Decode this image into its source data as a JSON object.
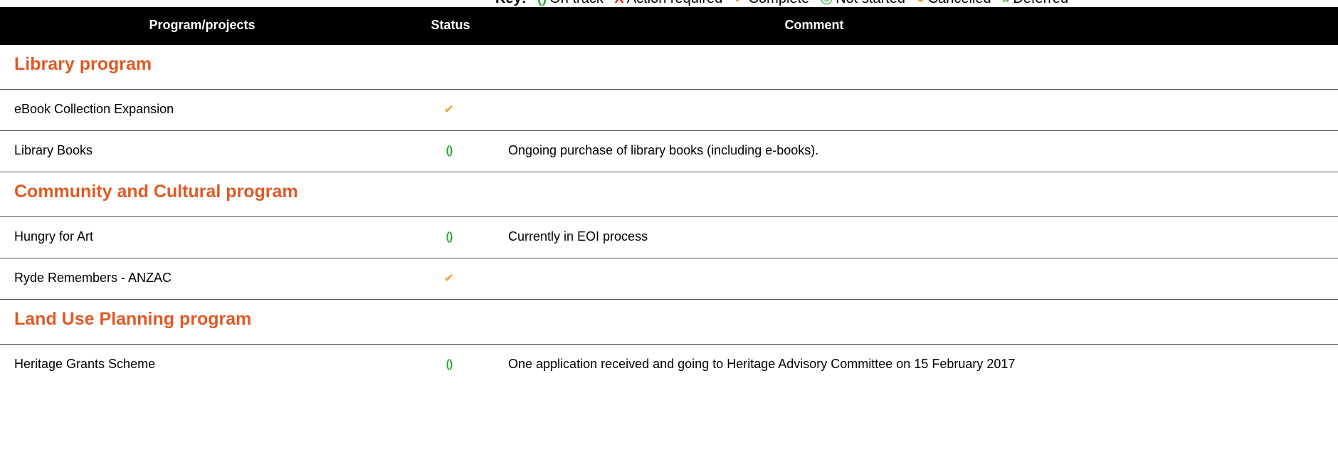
{
  "key": {
    "label": "Key:",
    "items": [
      {
        "icon": "progress-icon",
        "symbol": "()",
        "color": "#2eaa3a",
        "label": "On track"
      },
      {
        "icon": "cross-icon",
        "symbol": "X",
        "color": "#e03020",
        "label": "Action required"
      },
      {
        "icon": "check-icon",
        "symbol": "✔",
        "color": "#f0a030",
        "label": "Complete"
      },
      {
        "icon": "not-started-icon",
        "symbol": "◎",
        "color": "#2eaa3a",
        "label": "Not started"
      },
      {
        "icon": "cancelled-icon",
        "symbol": "●",
        "color": "#f0a030",
        "label": "Cancelled"
      },
      {
        "icon": "deferred-icon",
        "symbol": "»",
        "color": "#2eaa3a",
        "label": "Deferred"
      }
    ]
  },
  "header": {
    "program": "Program/projects",
    "status": "Status",
    "comment": "Comment"
  },
  "sections": [
    {
      "title": "Library program",
      "items": [
        {
          "name": "eBook Collection Expansion",
          "status": "complete",
          "status_icon": "check-icon",
          "symbol": "✔",
          "comment": ""
        },
        {
          "name": "Library Books",
          "status": "on-track",
          "status_icon": "progress-icon",
          "symbol": "()",
          "comment": "Ongoing purchase of library books (including e-books)."
        }
      ]
    },
    {
      "title": "Community and Cultural program",
      "items": [
        {
          "name": "Hungry for Art",
          "status": "on-track",
          "status_icon": "progress-icon",
          "symbol": "()",
          "comment": "Currently in EOI process"
        },
        {
          "name": "Ryde Remembers - ANZAC",
          "status": "complete",
          "status_icon": "check-icon",
          "symbol": "✔",
          "comment": ""
        }
      ]
    },
    {
      "title": "Land Use Planning program",
      "items": [
        {
          "name": "Heritage Grants Scheme",
          "status": "on-track",
          "status_icon": "progress-icon",
          "symbol": "()",
          "comment": "One application received and going to Heritage Advisory Committee on 15 February 2017"
        }
      ]
    }
  ],
  "colors": {
    "section_title": "#e05a26",
    "header_bg": "#000000",
    "header_text": "#ffffff",
    "complete": "#f0a030",
    "on_track": "#2eaa3a"
  }
}
